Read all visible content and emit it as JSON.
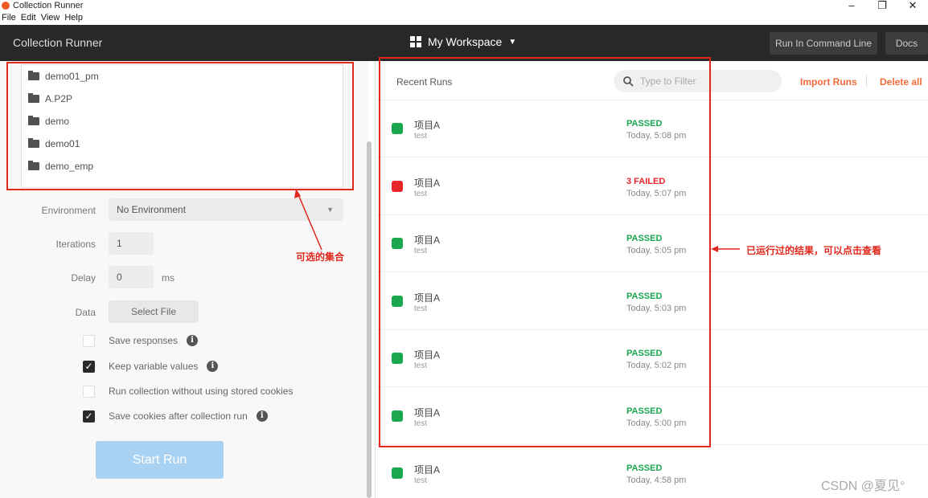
{
  "window": {
    "title": "Collection Runner",
    "controls": [
      "–",
      "❐",
      "✕"
    ]
  },
  "menu": [
    "File",
    "Edit",
    "View",
    "Help"
  ],
  "header": {
    "app_name": "Collection Runner",
    "workspace": "My Workspace",
    "run_cli": "Run In Command Line",
    "docs": "Docs"
  },
  "collections": [
    "demo01_pm",
    "A.P2P",
    "demo",
    "demo01",
    "demo_emp"
  ],
  "form": {
    "environment_label": "Environment",
    "environment_value": "No Environment",
    "iterations_label": "Iterations",
    "iterations_value": "1",
    "delay_label": "Delay",
    "delay_value": "0",
    "delay_unit": "ms",
    "data_label": "Data",
    "select_file": "Select File"
  },
  "options": [
    {
      "label": "Save responses",
      "checked": false,
      "info": true
    },
    {
      "label": "Keep variable values",
      "checked": true,
      "info": true
    },
    {
      "label": "Run collection without using stored cookies",
      "checked": false,
      "info": false
    },
    {
      "label": "Save cookies after collection run",
      "checked": true,
      "info": true
    }
  ],
  "start_run": "Start Run",
  "annotations": {
    "collections": "可选的集合",
    "runs": "已运行过的结果，可以点击查看"
  },
  "recent": {
    "title": "Recent Runs",
    "filter_placeholder": "Type to Filter",
    "import": "Import Runs",
    "delete_all": "Delete all"
  },
  "runs": [
    {
      "name": "项目A",
      "env": "test",
      "status": "PASSED",
      "time": "Today, 5:08 pm",
      "color": "#1aa84f"
    },
    {
      "name": "项目A",
      "env": "test",
      "status": "3 FAILED",
      "time": "Today, 5:07 pm",
      "color": "#e8262a"
    },
    {
      "name": "项目A",
      "env": "test",
      "status": "PASSED",
      "time": "Today, 5:05 pm",
      "color": "#1aa84f"
    },
    {
      "name": "项目A",
      "env": "test",
      "status": "PASSED",
      "time": "Today, 5:03 pm",
      "color": "#1aa84f"
    },
    {
      "name": "项目A",
      "env": "test",
      "status": "PASSED",
      "time": "Today, 5:02 pm",
      "color": "#1aa84f"
    },
    {
      "name": "项目A",
      "env": "test",
      "status": "PASSED",
      "time": "Today, 5:00 pm",
      "color": "#1aa84f"
    },
    {
      "name": "项目A",
      "env": "test",
      "status": "PASSED",
      "time": "Today, 4:58 pm",
      "color": "#1aa84f"
    }
  ],
  "colors": {
    "accent": "#f26b3a",
    "annotation": "#e0281d",
    "passed": "#1aa84f",
    "failed": "#e8262a"
  },
  "icons": {
    "folder": "folder-icon",
    "search": "search-icon",
    "info": "info-icon",
    "check": "check-icon",
    "workspace": "grid-icon"
  },
  "watermark": "CSDN @夏见°"
}
